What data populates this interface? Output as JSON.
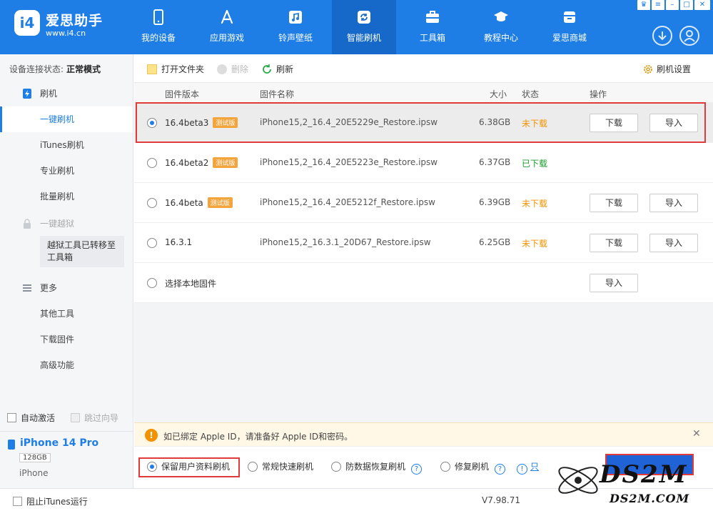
{
  "app": {
    "name": "爱思助手",
    "url": "www.i4.cn"
  },
  "nav": [
    {
      "label": "我的设备",
      "icon": "phone-icon"
    },
    {
      "label": "应用游戏",
      "icon": "app-store-icon"
    },
    {
      "label": "铃声壁纸",
      "icon": "music-icon"
    },
    {
      "label": "智能刷机",
      "icon": "refresh-icon"
    },
    {
      "label": "工具箱",
      "icon": "toolbox-icon"
    },
    {
      "label": "教程中心",
      "icon": "graduation-icon"
    },
    {
      "label": "爱思商城",
      "icon": "store-icon"
    }
  ],
  "sidebar": {
    "conn_label": "设备连接状态:",
    "conn_value": "正常模式",
    "flash_section": "刷机",
    "items": [
      "一键刷机",
      "iTunes刷机",
      "专业刷机",
      "批量刷机"
    ],
    "jailbreak": "一键越狱",
    "jb_note": "越狱工具已转移至工具箱",
    "more": "更多",
    "more_items": [
      "其他工具",
      "下载固件",
      "高级功能"
    ],
    "auto_activate": "自动激活",
    "skip_guide": "跳过向导",
    "device": {
      "name": "iPhone 14 Pro",
      "storage": "128GB",
      "type": "iPhone"
    }
  },
  "toolbar": {
    "open_folder": "打开文件夹",
    "delete": "删除",
    "refresh": "刷新",
    "settings": "刷机设置"
  },
  "table": {
    "headers": [
      "固件版本",
      "固件名称",
      "大小",
      "状态",
      "操作"
    ],
    "rows": [
      {
        "version": "16.4beta3",
        "badge": "测试版",
        "name": "iPhone15,2_16.4_20E5229e_Restore.ipsw",
        "size": "6.38GB",
        "status": "未下载",
        "download": "下载",
        "import": "导入"
      },
      {
        "version": "16.4beta2",
        "badge": "测试版",
        "name": "iPhone15,2_16.4_20E5223e_Restore.ipsw",
        "size": "6.37GB",
        "status": "已下载",
        "download": "",
        "import": ""
      },
      {
        "version": "16.4beta",
        "badge": "测试版",
        "name": "iPhone15,2_16.4_20E5212f_Restore.ipsw",
        "size": "6.39GB",
        "status": "未下载",
        "download": "下载",
        "import": "导入"
      },
      {
        "version": "16.3.1",
        "badge": "",
        "name": "iPhone15,2_16.3.1_20D67_Restore.ipsw",
        "size": "6.25GB",
        "status": "未下载",
        "download": "下载",
        "import": "导入"
      }
    ],
    "local": {
      "label": "选择本地固件",
      "import": "导入"
    }
  },
  "notice": "如已绑定 Apple ID，请准备好 Apple ID和密码。",
  "options": [
    "保留用户资料刷机",
    "常规快速刷机",
    "防数据恢复刷机",
    "修复刷机"
  ],
  "options_link": "只",
  "statusbar": {
    "itunes": "阻止iTunes运行",
    "version": "V7.98.71"
  },
  "watermark": {
    "big": "DS2M",
    "small": "DS2M.COM"
  },
  "colors": {
    "primary": "#1f7ee6",
    "warn": "#f39200",
    "ok": "#1a9a2c",
    "red_box": "#e03a3a"
  }
}
